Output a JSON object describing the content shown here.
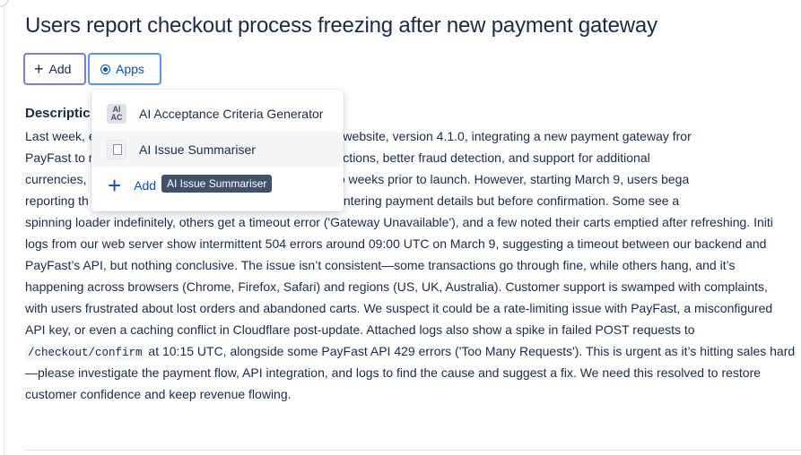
{
  "issue": {
    "title": "Users report checkout process freezing after new payment gateway"
  },
  "toolbar": {
    "add_label": "Add",
    "apps_label": "Apps"
  },
  "description": {
    "heading": "Descriptic",
    "lines": {
      "l1": "Last week, e",
      "l1b": "our e-commerce website, version 4.1.0, integrating a new payment gateway fror",
      "l2": "PayFast to r",
      "l2b": "omised faster transactions, better fraud detection, and support for additional",
      "l3": "currencies,",
      "l3b": "nvironment for two weeks prior to launch. However, starting March 9, users bega",
      "l4": "reporting th",
      "l4b": "ction, often after entering payment details but before confirmation. Some see a",
      "l5": "spinning loader indefinitely, others get a timeout error ('Gateway Unavailable'), and a few noted their carts emptied after refreshing. Initi",
      "l6": "logs from our web server show intermittent 504 errors around 09:00 UTC on March 9, suggesting a timeout between our backend and",
      "l7": "PayFast’s API, but nothing conclusive. The issue isn’t consistent—some transactions go through fine, while others hang, and it’s",
      "l8": "happening across browsers (Chrome, Firefox, Safari) and regions (US, UK, Australia). Customer support is swamped with complaints,",
      "l9": "with users frustrated about lost orders and abandoned carts. We suspect it could be a rate-limiting issue with PayFast, a misconfigured",
      "l10": "API key, or even a caching conflict in Cloudflare post-update. Attached logs also show a spike in failed POST requests to",
      "l11_code": "/checkout/confirm",
      "l11": " at 10:15 UTC, alongside some PayFast API 429 errors ('Too Many Requests'). This is urgent as it’s hitting sales hard",
      "l12": "—please investigate the payment flow, API integration, and logs to find the cause and suggest a fix. We need this resolved to restore",
      "l13": "customer confidence and keep revenue flowing."
    }
  },
  "apps_menu": {
    "items": [
      {
        "label": "AI Acceptance Criteria Generator",
        "icon_text_top": "AI",
        "icon_text_bottom": "AC",
        "icon": "ac-icon"
      },
      {
        "label": "AI Issue Summariser",
        "icon": "summariser-icon"
      },
      {
        "label": "Add",
        "icon": "plus-icon"
      }
    ],
    "tooltip": "AI Issue Summariser"
  },
  "colors": {
    "accent": "#0052cc",
    "add_border": "#8777d9",
    "apps_border": "#4c9aff",
    "tooltip_bg": "#42526e"
  }
}
